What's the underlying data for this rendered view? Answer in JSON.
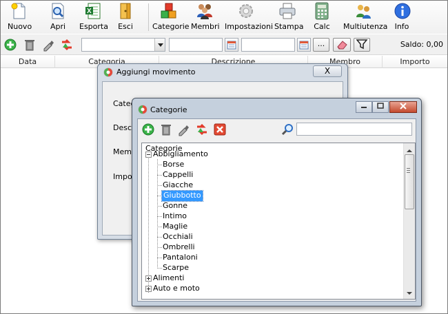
{
  "toolbar": {
    "nuovo": "Nuovo",
    "apri": "Apri",
    "esporta": "Esporta",
    "esci": "Esci",
    "categorie": "Categorie",
    "membri": "Membri",
    "impostazioni": "Impostazioni",
    "stampa": "Stampa",
    "calc": "Calc",
    "multiutenza": "Multiutenza",
    "info": "Info"
  },
  "filterbar": {
    "dots_label": "...",
    "saldo": "Saldo:  0,00"
  },
  "table": {
    "columns": [
      "Data",
      "Categoria",
      "Descrizione",
      "Membro",
      "Importo"
    ]
  },
  "dialog_movimento": {
    "title": "Aggiungi movimento",
    "close_label": "X",
    "labels": [
      "Catego",
      "Descri",
      "Memb",
      "Impor"
    ]
  },
  "dialog_categorie": {
    "title": "Categorie",
    "tree_root": "Categorie",
    "nodes": [
      {
        "label": "Abbigliamento",
        "expanded": true,
        "children": [
          "Borse",
          "Cappelli",
          "Giacche",
          "Giubbotto",
          "Gonne",
          "Intimo",
          "Maglie",
          "Occhiali",
          "Ombrelli",
          "Pantaloni",
          "Scarpe"
        ],
        "selected_child": "Giubbotto"
      },
      {
        "label": "Alimenti",
        "expanded": false
      },
      {
        "label": "Auto e moto",
        "expanded": false
      }
    ]
  },
  "colors": {
    "selection": "#3399ff",
    "dialog_frame": "#c5d0dd"
  }
}
